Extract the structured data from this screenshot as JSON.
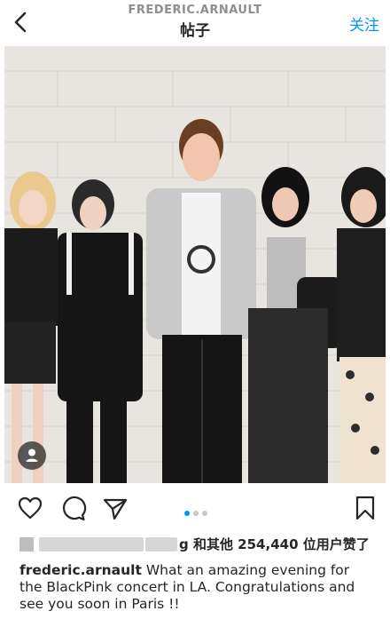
{
  "header": {
    "username": "FREDERIC.ARNAULT",
    "title": "帖子",
    "follow_label": "关注",
    "back_icon": "chevron-left-icon"
  },
  "post": {
    "photo_description_icon": "photo",
    "carousel": {
      "count": 3,
      "active_index": 0
    },
    "likes_text": "g 和其他 254,440 位用户赞了",
    "caption_username": "frederic.arnault",
    "caption_text": "What an amazing evening for the BlackPink concert in LA. Congratulations and see you soon in Paris !!"
  },
  "actions": {
    "like_icon": "heart-icon",
    "comment_icon": "comment-icon",
    "share_icon": "send-icon",
    "save_icon": "bookmark-icon"
  },
  "colors": {
    "accent": "#0095f6",
    "text": "#262626",
    "muted": "#8e8e8e"
  }
}
